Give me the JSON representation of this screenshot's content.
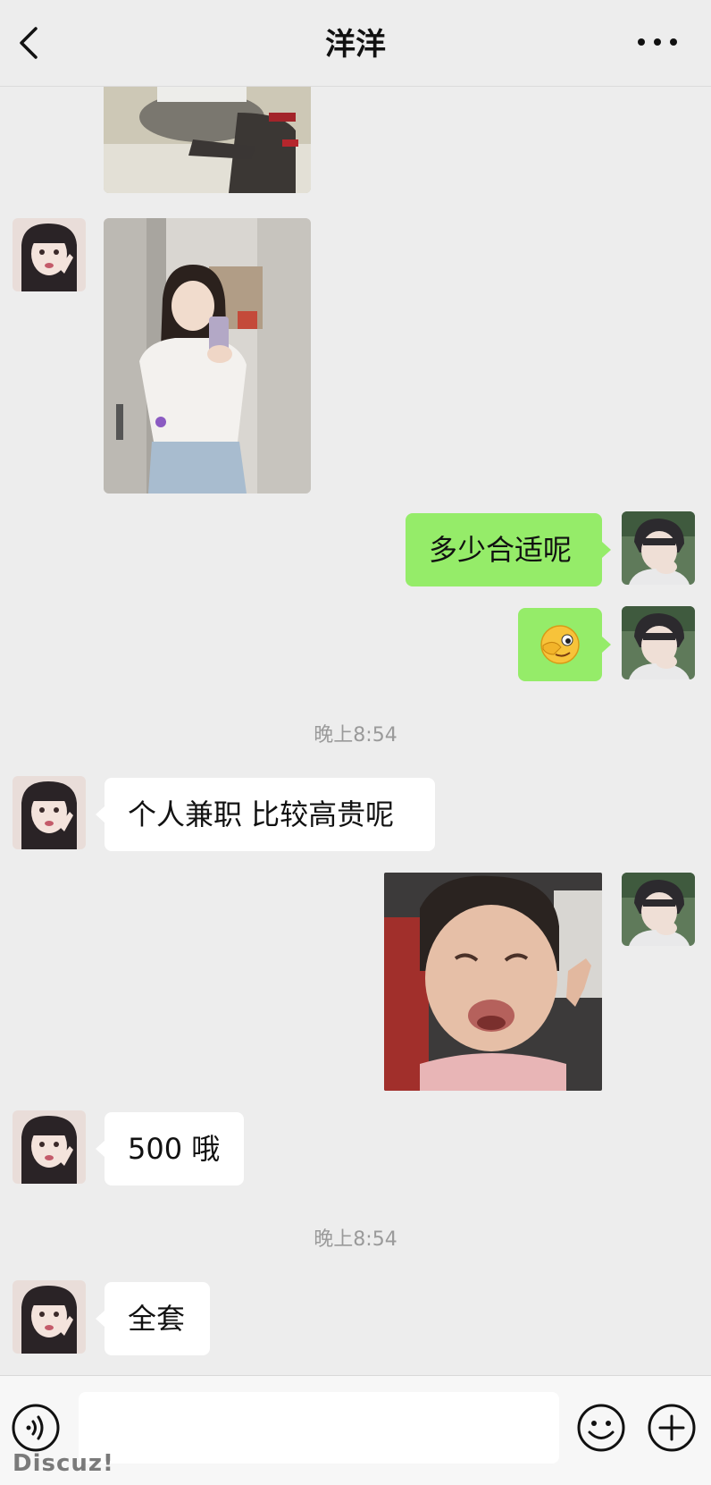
{
  "header": {
    "title": "洋洋"
  },
  "messages": {
    "m3_text": "多少合适呢",
    "m4_emoji": "emoji-face-wink",
    "ts1": "晚上8:54",
    "m5_text": "个人兼职 比较高贵呢",
    "m7_text": "500 哦",
    "ts2": "晚上8:54",
    "m8_text": "全套"
  },
  "input": {
    "placeholder": ""
  },
  "watermark": "Discuz!",
  "colors": {
    "background": "#ededed",
    "sent_bubble": "#95ec69",
    "received_bubble": "#ffffff"
  }
}
